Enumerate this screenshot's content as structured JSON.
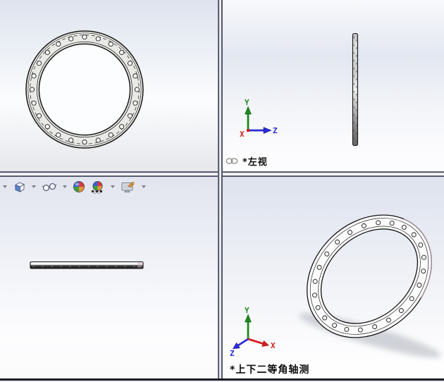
{
  "viewport_labels": {
    "top_right": "*左视",
    "bottom_right": "*上下二等角轴测"
  },
  "triad": {
    "x": "X",
    "y": "Y",
    "z": "Z"
  },
  "toolbar": {
    "buttons": [
      {
        "name": "view-orientation",
        "icon": "cube-icon"
      },
      {
        "name": "display-style",
        "icon": "glasses-icon"
      },
      {
        "name": "edit-appearance",
        "icon": "color-sphere-icon"
      },
      {
        "name": "apply-scene",
        "icon": "scene-sphere-icon"
      },
      {
        "name": "view-settings",
        "icon": "monitor-hand-icon"
      }
    ],
    "dropdown_icon": "dropdown-caret-icon"
  },
  "linked_view_icon": "link-icon",
  "part": {
    "bolt_hole_count": 24
  },
  "colors": {
    "axis_x": "#d42020",
    "axis_y": "#1c8a1c",
    "axis_z": "#2a2ad6",
    "divider": "#5c6174",
    "flange_fill": "#e9e9e5",
    "viewport_bg_mid": "#e3e7f1",
    "label_text": "#0d0d0d"
  }
}
